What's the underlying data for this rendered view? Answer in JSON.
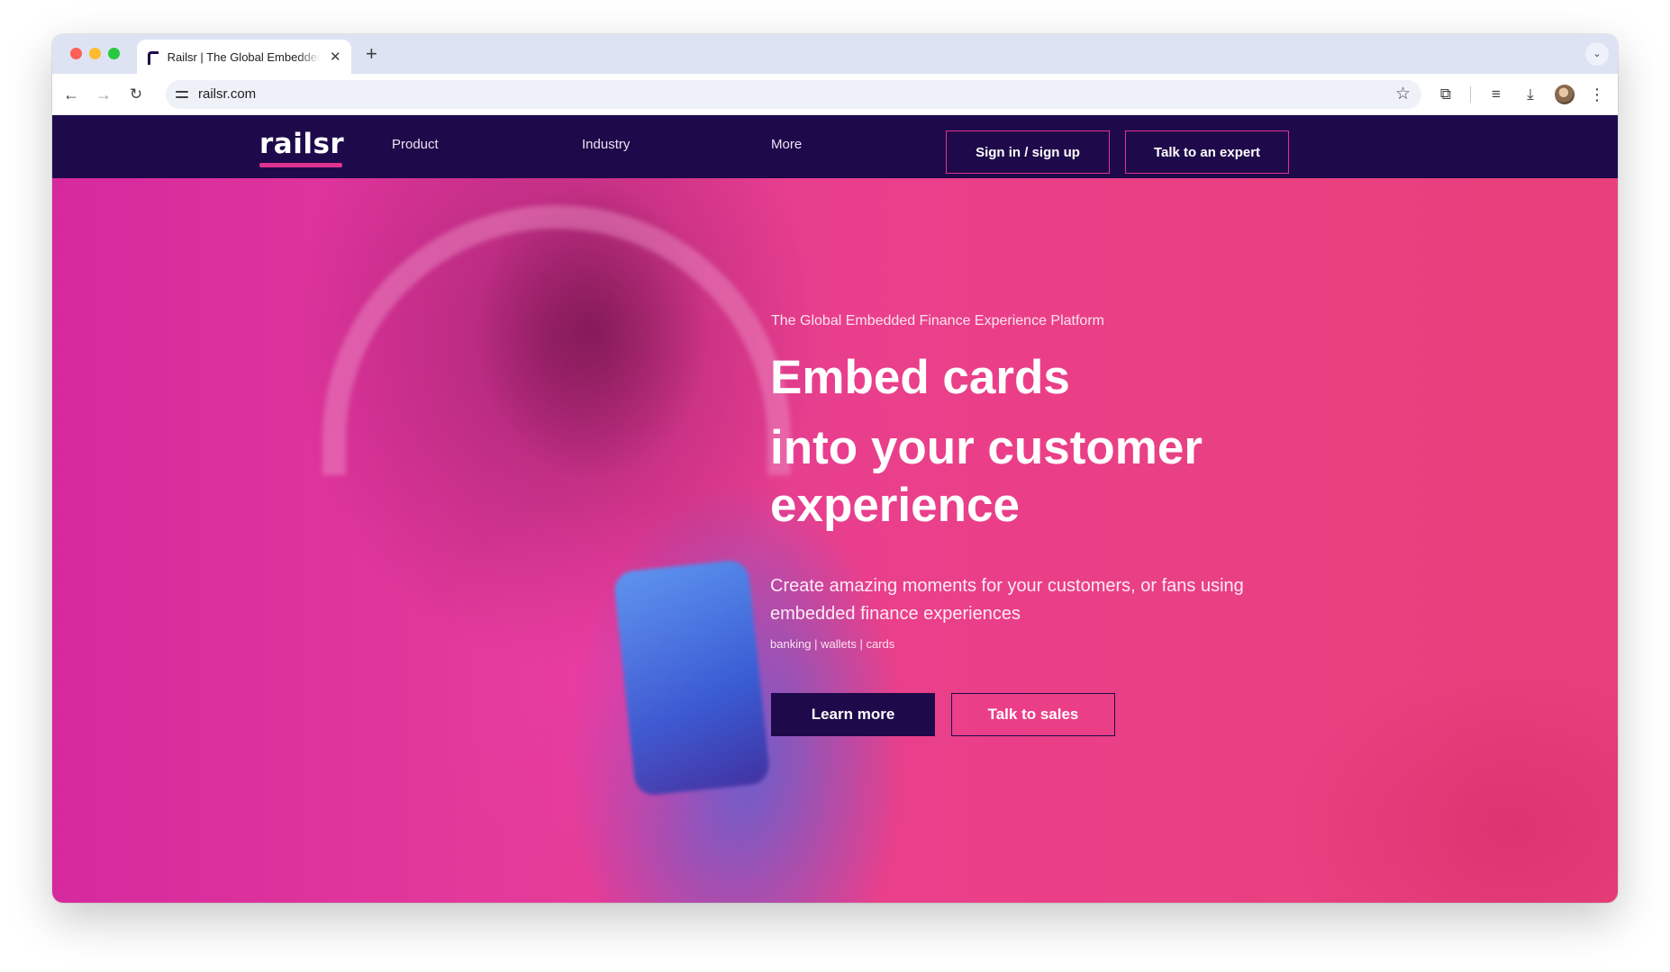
{
  "browser": {
    "tab_title": "Railsr | The Global Embedded Finance Experience Platform",
    "url": "railsr.com",
    "icons": {
      "back": "arrow-left-icon",
      "forward": "arrow-right-icon",
      "reload": "reload-icon",
      "site_info": "site-settings-icon",
      "bookmark": "star-icon",
      "extensions": "puzzle-icon",
      "media": "media-control-icon",
      "downloads": "download-icon",
      "menu": "kebab-menu-icon"
    }
  },
  "site": {
    "logo": "railsr",
    "nav": {
      "product": "Product",
      "industry": "Industry",
      "more": "More",
      "signin": "Sign in / sign up",
      "expert": "Talk to an expert"
    },
    "hero": {
      "eyebrow": "The Global Embedded Finance Experience Platform",
      "headline_1": "Embed cards",
      "headline_2": "into your customer experience",
      "subcopy": "Create amazing moments for your customers, or fans using embedded finance experiences",
      "tags": "banking | wallets | cards",
      "cta_primary": "Learn more",
      "cta_secondary": "Talk to sales"
    }
  },
  "colors": {
    "brand_navy": "#1e0a4a",
    "brand_pink": "#e0338f",
    "hero_pink": "#e8407a"
  }
}
